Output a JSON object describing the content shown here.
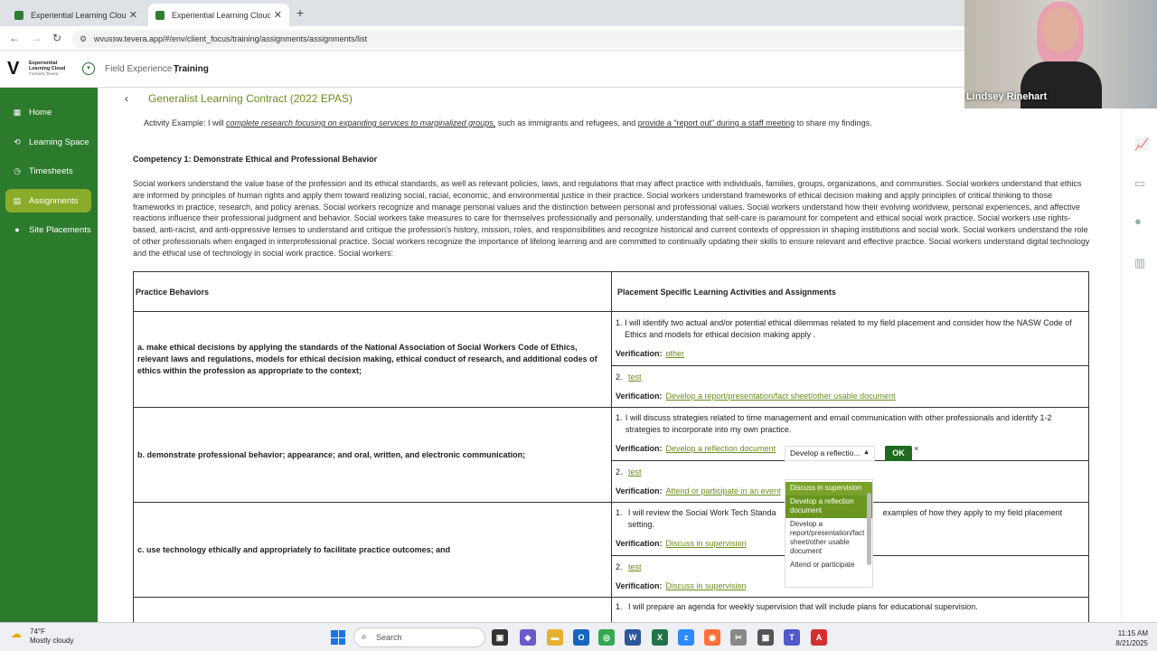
{
  "browser": {
    "tabs": [
      {
        "title": "Experiential Learning Cloud (fo",
        "active": false
      },
      {
        "title": "Experiential Learning Cloud (fo",
        "active": true
      }
    ],
    "new_tab_glyph": "+",
    "url": "wvussw.tevera.app/#/env/client_focus/training/assignments/assignments/list"
  },
  "app_header": {
    "logo_glyph": "V",
    "logo_text": "Experiential Learning Cloud",
    "logo_sub": "Formerly Tevera",
    "crumb_section": "Field Experience |",
    "crumb_page": "Training"
  },
  "sidebar": {
    "items": [
      {
        "label": "Home",
        "icon": "home-icon",
        "active": false
      },
      {
        "label": "Learning Space",
        "icon": "learning-space-icon",
        "active": false
      },
      {
        "label": "Timesheets",
        "icon": "clock-icon",
        "active": false
      },
      {
        "label": "Assignments",
        "icon": "assignments-icon",
        "active": true
      },
      {
        "label": "Site Placements",
        "icon": "location-pin-icon",
        "active": false
      }
    ]
  },
  "page": {
    "title": "Generalist Learning Contract (2022 EPAS)",
    "user_name": "Lindsey Rinehart",
    "activity_example": {
      "prefix": "Activity Example: I will ",
      "u1": "complete research focusing on expanding services to marginalized groups,",
      "mid": " such as immigrants and refugees, and ",
      "u2": "provide a \"report out\" during a staff meeting",
      "suffix": " to share my findings."
    },
    "competency_title": "Competency 1: Demonstrate Ethical and Professional Behavior",
    "competency_body": "Social workers understand the value base of the profession and its ethical standards, as well as relevant policies, laws, and regulations that may affect practice with individuals, families, groups, organizations, and communities. Social workers understand that ethics are informed by principles of human rights and apply them toward realizing social, racial, economic, and environmental justice in their practice. Social workers understand frameworks of ethical decision making and apply principles of critical thinking to those frameworks in practice, research, and policy arenas. Social workers recognize and manage personal values and the distinction between personal and professional values. Social workers understand how their evolving worldview, personal experiences, and affective reactions influence their professional judgment and behavior. Social workers take measures to care for themselves professionally and personally, understanding that self-care is paramount for competent and ethical social work practice. Social workers use rights-based, anti-racist, and anti-oppressive lenses to understand and critique the profession's history, mission, roles, and responsibilities and recognize historical and current contexts of oppression in shaping institutions and social work. Social workers understand the role of other professionals when engaged in interprofessional practice. Social workers recognize the importance of lifelong learning and are committed to continually updating their skills to ensure relevant and effective practice. Social workers understand digital technology and the ethical use of technology in social work practice. Social workers:"
  },
  "table": {
    "col_headers": [
      "Practice Behaviors",
      "Placement Specific Learning Activities and Assignments"
    ],
    "verification_label": "Verification:",
    "rows": [
      {
        "behavior": "a. make ethical decisions by applying the standards of the National Association of Social Workers Code of Ethics, relevant laws and regulations, models for ethical decision making, ethical conduct of research, and additional codes of ethics within the profession as appropriate to the context;",
        "activities": [
          {
            "num": "1.",
            "text": "I will identify two actual and/or potential ethical dilemmas related to my field placement and consider how the NASW Code of Ethics and models for ethical decision making apply .",
            "verification": "other"
          },
          {
            "num": "2.",
            "text": "test",
            "verification": "Develop a report/presentation/fact sheet/other usable document"
          }
        ]
      },
      {
        "behavior": "b. demonstrate professional behavior; appearance; and oral, written, and electronic communication;",
        "activities": [
          {
            "num": "1.",
            "text": "I will discuss strategies related to time management and email communication with other professionals and identify 1-2 strategies to incorporate into my own practice.",
            "verification": "Develop a reflection document"
          },
          {
            "num": "2.",
            "text": "test",
            "verification": "Attend or participate in an event"
          }
        ]
      },
      {
        "behavior": "c. use technology ethically and appropriately to facilitate practice outcomes; and",
        "activities": [
          {
            "num": "1.",
            "text": "I will review the Social Work Tech Standa",
            "text_tail": "examples of how they apply to my field placement setting.",
            "verification": "Discuss in supervision"
          },
          {
            "num": "2.",
            "text": "test",
            "verification": "Discuss in supervision"
          }
        ]
      },
      {
        "behavior": "",
        "activities": [
          {
            "num": "1.",
            "text": "I will prepare an agenda for weekly supervision that will include plans for educational supervision."
          }
        ]
      }
    ]
  },
  "dropdown": {
    "selected": "Develop a reflectio...",
    "ok_label": "OK",
    "close_glyph": "×",
    "options": [
      {
        "label": "Discuss in supervision",
        "state": "selected"
      },
      {
        "label": "Develop a reflection document",
        "state": "hover"
      },
      {
        "label": "Develop a report/presentation/fact sheet/other usable document",
        "state": "normal"
      },
      {
        "label": "Attend or participate",
        "state": "normal"
      }
    ]
  },
  "taskbar": {
    "weather_temp": "74°F",
    "weather_desc": "Mostly cloudy",
    "search_placeholder": "Search",
    "time": "11:15 AM",
    "date": "8/21/2025"
  },
  "colors": {
    "sidebar": "#2c7a2c",
    "sidebar_active": "#8aac2a",
    "link": "#6a8c1a",
    "ok_button": "#1e6b1e"
  }
}
